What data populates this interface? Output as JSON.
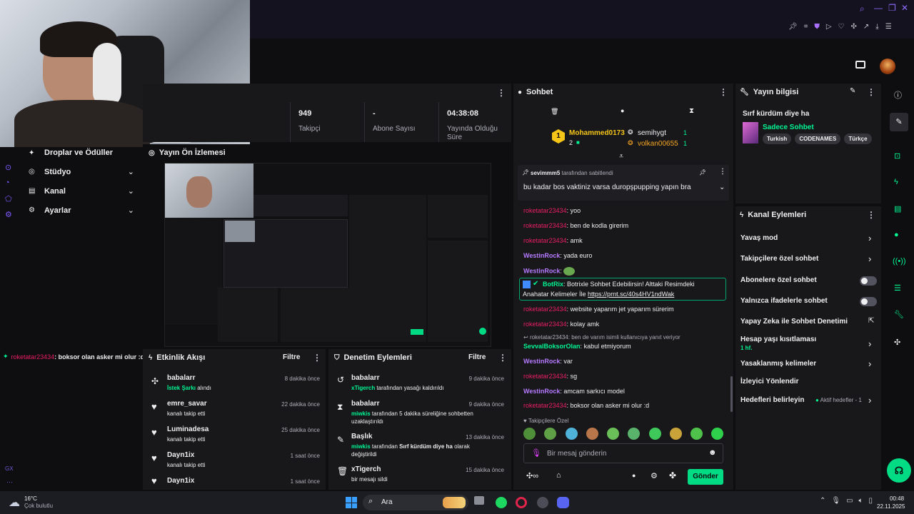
{
  "stats": {
    "followers_value": "949",
    "followers_label": "Takipçi",
    "subs_value": "-",
    "subs_label": "Abone Sayısı",
    "uptime_value": "04:38:08",
    "uptime_label": "Yayında Olduğu Süre"
  },
  "left_nav": {
    "items": [
      {
        "label": "Droplar ve Ödüller"
      },
      {
        "label": "Stüdyo"
      },
      {
        "label": "Kanal"
      },
      {
        "label": "Ayarlar"
      }
    ]
  },
  "overlay_chat": {
    "user": "roketatar23434",
    "message": ": boksor olan asker mi olur :d"
  },
  "preview": {
    "title": "Yayın Ön İzlemesi"
  },
  "activity": {
    "title": "Etkinlik Akışı",
    "filter": "Filtre",
    "items": [
      {
        "user": "babalarr",
        "detail_green": "İstek Şarkı",
        "detail": " alındı",
        "time": "8 dakika önce"
      },
      {
        "user": "emre_savar",
        "detail_green": "",
        "detail": "kanalı takip etti",
        "time": "22 dakika önce"
      },
      {
        "user": "Luminadesa",
        "detail_green": "",
        "detail": "kanalı takip etti",
        "time": "25 dakika önce"
      },
      {
        "user": "Dayn1ix",
        "detail_green": "",
        "detail": "kanalı takip etti",
        "time": "1 saat önce"
      },
      {
        "user": "Dayn1ix",
        "detail_green": "",
        "detail": "",
        "time": "1 saat önce"
      }
    ]
  },
  "moderation": {
    "title": "Denetim Eylemleri",
    "filter": "Filtre",
    "items": [
      {
        "user": "babalarr",
        "actor": "xTigerch",
        "detail": " tarafından yasağı kaldırıldı",
        "extra": "",
        "time": "9 dakika önce"
      },
      {
        "user": "babalarr",
        "actor": "miwkis",
        "detail": " tarafından 5 dakika süreliğine sohbetten",
        "extra": "uzaklaştırıldı",
        "time": "9 dakika önce"
      },
      {
        "user": "Başlık",
        "actor": "miwkis",
        "detail": " tarafından ",
        "bold": "Sırf kürdüm diye ha",
        "detail2": " olarak",
        "extra": "değiştirildi",
        "time": "13 dakika önce"
      },
      {
        "user": "xTigerch",
        "actor": "",
        "detail": "bir mesajı sildi",
        "extra": "",
        "time": "15 dakika önce"
      }
    ]
  },
  "chat": {
    "title": "Sohbet",
    "leaderboard": {
      "rank": "1",
      "top_user": "Mohammed0173",
      "top_count": "2",
      "user2": "semihygt",
      "user2_count": "1",
      "user3": "volkan00655",
      "user3_count": "1"
    },
    "pinned_by": "sevimmm5",
    "pinned_by_suffix": "tarafından sabitlendi",
    "pinned_message": "bu kadar bos vaktiniz varsa duropşpupping yapın bra",
    "messages": [
      {
        "user": "roketatar23434",
        "color": "#e91e63",
        "text": "yoo"
      },
      {
        "user": "roketatar23434",
        "color": "#e91e63",
        "text": "ben de kodla girerim"
      },
      {
        "user": "roketatar23434",
        "color": "#e91e63",
        "text": "amk"
      },
      {
        "user": "WestinRock",
        "color": "#b57aff",
        "text": "yada euro"
      },
      {
        "user": "WestinRock",
        "color": "#b57aff",
        "text": ""
      },
      {
        "user": "BotRix",
        "color": "#00f593",
        "text": "Botrixle Sohbet Edebilirsin!",
        "line2_a": "Anahatar Kelimeler İle ",
        "link": "https://prnt.sc/40s4HV1ndWak",
        "tail": " Alttaki Resimdeki"
      },
      {
        "user": "roketatar23434",
        "color": "#e91e63",
        "text": "website yaparım jet yaparım sürerim"
      },
      {
        "user": "roketatar23434",
        "color": "#e91e63",
        "text": "kolay amk"
      },
      {
        "reply": "roketatar23434: ben de varım isimli kullanıcıya yanıt veriyor",
        "user": "SevvalBoksorOlan",
        "color": "#00f593",
        "text": "kabul etmiyorum"
      },
      {
        "user": "WestinRock",
        "color": "#b57aff",
        "text": "var"
      },
      {
        "user": "roketatar23434",
        "color": "#e91e63",
        "text": "sg"
      },
      {
        "user": "WestinRock",
        "color": "#b57aff",
        "text": "amcam sarkıcı model"
      },
      {
        "user": "roketatar23434",
        "color": "#e91e63",
        "text": "boksor olan asker mi olur :d"
      }
    ],
    "emote_section": "Takipçilere Özel",
    "input_placeholder": "Bir mesaj gönderin",
    "send_label": "Gönder"
  },
  "stream_info": {
    "title": "Yayın bilgisi",
    "stream_title": "Sırf kürdüm diye ha",
    "category": "Sadece Sohbet",
    "tags": [
      "Turkish",
      "CODENAMES",
      "Türkçe"
    ]
  },
  "channel_actions": {
    "title": "Kanal Eylemleri",
    "items": [
      {
        "label": "Yavaş mod",
        "kind": "chevron"
      },
      {
        "label": "Takipçilere özel sohbet",
        "kind": "chevron"
      },
      {
        "label": "Abonelere özel sohbet",
        "kind": "toggle"
      },
      {
        "label": "Yalnızca ifadelerle sohbet",
        "kind": "toggle"
      },
      {
        "label": "Yapay Zeka ile Sohbet Denetimi",
        "kind": "external"
      },
      {
        "label": "Hesap yaşı kısıtlaması",
        "sub": "1 hf.",
        "kind": "chevron"
      },
      {
        "label": "Yasaklanmış kelimeler",
        "kind": "chevron"
      },
      {
        "label": "İzleyici Yönlendir",
        "kind": "none"
      },
      {
        "label": "Hedefleri belirleyin",
        "status": "Aktif hedefler - 1",
        "kind": "chevron"
      }
    ]
  },
  "taskbar": {
    "weather_temp": "16°C",
    "weather_desc": "Çok bulutlu",
    "search": "Ara",
    "time": "00:48",
    "date": "22.11.2025"
  },
  "colors": {
    "accent": "#00db84",
    "panel": "#18181b",
    "background": "#0e0e10",
    "user_pink": "#e91e63",
    "user_purple": "#b57aff"
  }
}
